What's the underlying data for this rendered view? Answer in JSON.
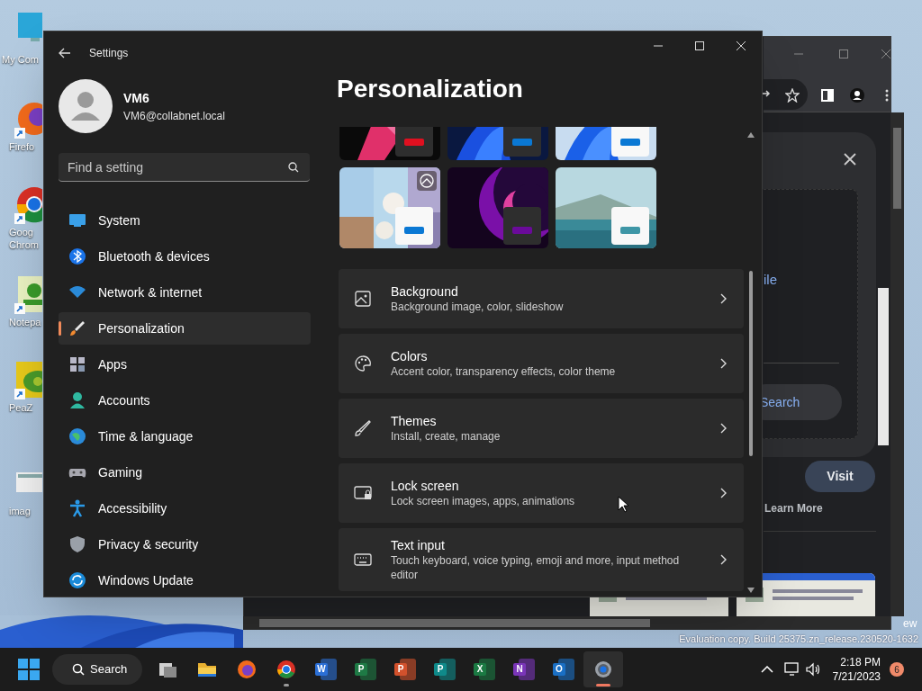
{
  "desktop": {
    "icons": [
      {
        "lines": [
          "My Com"
        ]
      },
      {
        "lines": [
          "Firefo"
        ]
      },
      {
        "lines": [
          "Goog",
          "Chrom"
        ]
      },
      {
        "lines": [
          "Notepa"
        ]
      },
      {
        "lines": [
          "PeaZ"
        ]
      },
      {
        "lines": [
          "imag"
        ]
      }
    ],
    "watermark": "Evaluation copy. Build 25375.zn_release.230520-1632"
  },
  "browser": {
    "dialog_text": "ile",
    "search_button": "Search",
    "visit_button": "Visit",
    "learn_more": "Learn More",
    "edge_text": "ew"
  },
  "settings": {
    "window": {
      "title": "Settings"
    },
    "user": {
      "name": "VM6",
      "email": "VM6@collabnet.local"
    },
    "search": {
      "placeholder": "Find a setting"
    },
    "nav": [
      {
        "label": "System",
        "selected": false
      },
      {
        "label": "Bluetooth & devices",
        "selected": false
      },
      {
        "label": "Network & internet",
        "selected": false
      },
      {
        "label": "Personalization",
        "selected": true
      },
      {
        "label": "Apps",
        "selected": false
      },
      {
        "label": "Accounts",
        "selected": false
      },
      {
        "label": "Time & language",
        "selected": false
      },
      {
        "label": "Gaming",
        "selected": false
      },
      {
        "label": "Accessibility",
        "selected": false
      },
      {
        "label": "Privacy & security",
        "selected": false
      },
      {
        "label": "Windows Update",
        "selected": false
      }
    ],
    "heading": "Personalization",
    "themes": [
      {
        "kind": "dark",
        "color": "#e01020",
        "slideshow": false
      },
      {
        "kind": "dark",
        "color": "#0a78d4",
        "slideshow": false
      },
      {
        "kind": "light",
        "color": "#0a78d4",
        "slideshow": false
      },
      {
        "kind": "light",
        "color": "#0a78d4",
        "slideshow": true
      },
      {
        "kind": "dark",
        "color": "#6a0a9a",
        "slideshow": false
      },
      {
        "kind": "light",
        "color": "#3e96a6",
        "slideshow": false
      }
    ],
    "cards": [
      {
        "title": "Background",
        "subtitle": "Background image, color, slideshow"
      },
      {
        "title": "Colors",
        "subtitle": "Accent color, transparency effects, color theme"
      },
      {
        "title": "Themes",
        "subtitle": "Install, create, manage"
      },
      {
        "title": "Lock screen",
        "subtitle": "Lock screen images, apps, animations"
      },
      {
        "title": "Text input",
        "subtitle": "Touch keyboard, voice typing, emoji and more, input method editor"
      }
    ]
  },
  "taskbar": {
    "search": "Search",
    "apps": [
      {
        "kind": "taskview",
        "running": false,
        "active": false
      },
      {
        "kind": "folder",
        "running": false,
        "active": false
      },
      {
        "kind": "firefox",
        "running": false,
        "active": false
      },
      {
        "kind": "chrome",
        "running": true,
        "active": false
      },
      {
        "kind": "office",
        "letter": "W",
        "color": "#2b6fd6",
        "running": false,
        "active": false
      },
      {
        "kind": "office",
        "letter": "P",
        "color": "#1e7a45",
        "running": false,
        "active": false
      },
      {
        "kind": "office",
        "letter": "P",
        "color": "#d2512c",
        "running": false,
        "active": false
      },
      {
        "kind": "office",
        "letter": "P",
        "color": "#0f8a8a",
        "running": false,
        "active": false
      },
      {
        "kind": "office",
        "letter": "X",
        "color": "#1b7a43",
        "running": false,
        "active": false
      },
      {
        "kind": "office",
        "letter": "N",
        "color": "#7a35b8",
        "running": false,
        "active": false
      },
      {
        "kind": "office",
        "letter": "O",
        "color": "#1a6fc4",
        "running": false,
        "active": false
      },
      {
        "kind": "settings",
        "running": true,
        "active": true
      }
    ],
    "time": "2:18 PM",
    "date": "7/21/2023",
    "badge": "6"
  }
}
